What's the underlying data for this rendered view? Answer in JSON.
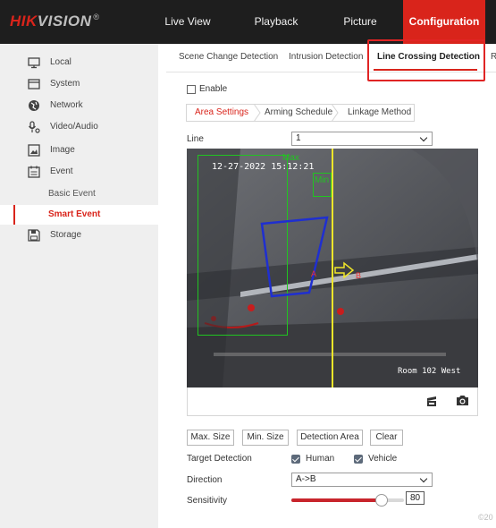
{
  "brand": {
    "logo_red": "HIK",
    "logo_grey": "VISION",
    "logo_reg": "®"
  },
  "topnav": {
    "live_view": "Live View",
    "playback": "Playback",
    "picture": "Picture",
    "configuration": "Configuration"
  },
  "sidebar": {
    "items": [
      {
        "label": "Local",
        "icon": "monitor-icon"
      },
      {
        "label": "System",
        "icon": "system-icon"
      },
      {
        "label": "Network",
        "icon": "globe-icon"
      },
      {
        "label": "Video/Audio",
        "icon": "microphone-icon"
      },
      {
        "label": "Image",
        "icon": "image-icon"
      },
      {
        "label": "Event",
        "icon": "calendar-icon"
      }
    ],
    "sub_items": [
      {
        "label": "Basic Event"
      },
      {
        "label": "Smart Event"
      }
    ],
    "storage": {
      "label": "Storage",
      "icon": "save-icon"
    }
  },
  "subtabs": {
    "scene_change": "Scene Change Detection",
    "intrusion": "Intrusion Detection",
    "line_crossing": "Line Crossing Detection",
    "truncated": "R"
  },
  "enable": {
    "label": "Enable",
    "checked": false
  },
  "steps": {
    "area_settings": "Area Settings",
    "arming_schedule": "Arming Schedule",
    "linkage_method": "Linkage Method"
  },
  "line": {
    "label": "Line",
    "value": "1"
  },
  "video": {
    "timestamp": "12-27-2022 15:12:21",
    "max_label": "Max",
    "min_label": "Min",
    "camera_name": "Room 102 West",
    "marker_a": "A",
    "marker_b": "B"
  },
  "buttons": {
    "max_size": "Max. Size",
    "min_size": "Min. Size",
    "detection_area": "Detection Area",
    "clear": "Clear"
  },
  "target_detection": {
    "label": "Target Detection",
    "human": "Human",
    "human_checked": true,
    "vehicle": "Vehicle",
    "vehicle_checked": true
  },
  "direction": {
    "label": "Direction",
    "value": "A->B"
  },
  "sensitivity": {
    "label": "Sensitivity",
    "value": "80",
    "level": 0.8
  },
  "footer": {
    "copyright": "©20"
  },
  "colors": {
    "accent": "#d9241b",
    "topbar": "#1e1e1e",
    "sidebar": "#efefef",
    "highlight": "#e02424"
  }
}
